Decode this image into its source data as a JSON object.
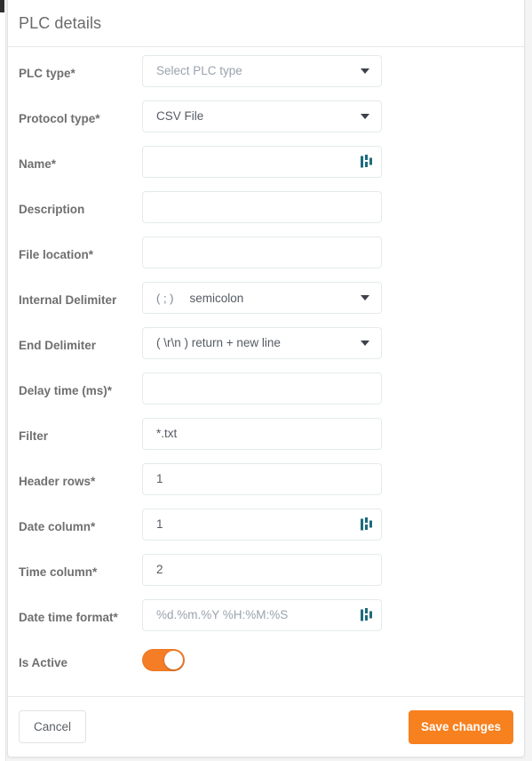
{
  "panel": {
    "title": "PLC details"
  },
  "fields": [
    {
      "label": "PLC type*",
      "type": "select",
      "value": "Select PLC type",
      "is_placeholder": true,
      "has_bars_icon": false
    },
    {
      "label": "Protocol type*",
      "type": "select",
      "value": "CSV File",
      "is_placeholder": false,
      "has_bars_icon": false
    },
    {
      "label": "Name*",
      "type": "text",
      "value": "",
      "is_placeholder": false,
      "has_bars_icon": true
    },
    {
      "label": "Description",
      "type": "text",
      "value": "",
      "is_placeholder": false,
      "has_bars_icon": false
    },
    {
      "label": "File location*",
      "type": "text",
      "value": "",
      "is_placeholder": false,
      "has_bars_icon": false
    },
    {
      "label": "Internal Delimiter",
      "type": "select-delimiter",
      "token": "( ; )",
      "value": "semicolon",
      "is_placeholder": false,
      "has_bars_icon": false
    },
    {
      "label": "End Delimiter",
      "type": "select-single",
      "value": "( \\r\\n ) return + new line",
      "is_placeholder": false,
      "has_bars_icon": false
    },
    {
      "label": "Delay time (ms)*",
      "type": "text",
      "value": "",
      "is_placeholder": false,
      "has_bars_icon": false
    },
    {
      "label": "Filter",
      "type": "text",
      "value": "*.txt",
      "is_placeholder": false,
      "has_bars_icon": false
    },
    {
      "label": "Header rows*",
      "type": "text",
      "value": "1",
      "is_placeholder": false,
      "has_bars_icon": false
    },
    {
      "label": "Date column*",
      "type": "text",
      "value": "1",
      "is_placeholder": false,
      "has_bars_icon": true
    },
    {
      "label": "Time column*",
      "type": "text",
      "value": "2",
      "is_placeholder": false,
      "has_bars_icon": false
    },
    {
      "label": "Date time format*",
      "type": "text",
      "value": "%d.%m.%Y %H:%M:%S",
      "is_placeholder": true,
      "has_bars_icon": true
    },
    {
      "label": "Is Active",
      "type": "toggle",
      "value": "on",
      "is_placeholder": false,
      "has_bars_icon": false
    }
  ],
  "footer": {
    "cancel_label": "Cancel",
    "save_label": "Save changes"
  },
  "colors": {
    "accent_orange": "#f7801f",
    "toggle_on": "#f47d26",
    "icon_teal": "#1d6b7d",
    "label_gray": "#6f6f6f",
    "value_gray": "#555b63",
    "placeholder_gray": "#9aa3ad",
    "border_gray": "#e4eaea"
  },
  "icons": {
    "bars": "bars-icon",
    "caret": "chevron-down-icon"
  }
}
